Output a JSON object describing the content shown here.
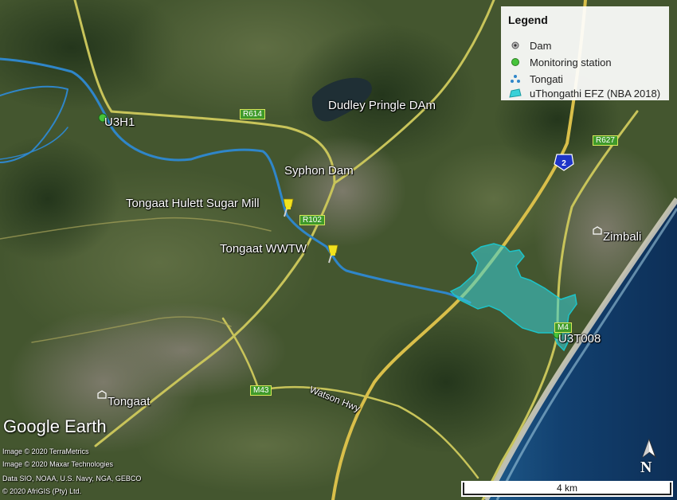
{
  "legend": {
    "title": "Legend",
    "items": [
      {
        "label": "Dam",
        "icon": "dam-point-icon"
      },
      {
        "label": "Monitoring station",
        "icon": "green-circle-icon"
      },
      {
        "label": "Tongati",
        "icon": "river-line-icon"
      },
      {
        "label": "uThongathi EFZ (NBA 2018)",
        "icon": "cyan-polygon-icon"
      }
    ]
  },
  "places": {
    "dudley": "Dudley Pringle DAm",
    "syphon": "Syphon Dam",
    "sugar_mill": "Tongaat Hulett Sugar Mill",
    "wwtw": "Tongaat WWTW",
    "zimbali": "Zimbali",
    "tongaat": "Tongaat",
    "u3h1": "U3H1",
    "u3t008": "U3T008",
    "watson": "Watson Hwy"
  },
  "roads": {
    "r614": "R614",
    "r102": "R102",
    "r627": "R627",
    "m4": "M4",
    "m43": "M43",
    "n2": "2"
  },
  "credits": [
    "Image © 2020 TerraMetrics",
    "Image © 2020 Maxar Technologies",
    "Data SIO, NOAA, U.S. Navy, NGA, GEBCO",
    "© 2020 AfriGIS (Pty) Ltd."
  ],
  "logo": "Google Earth",
  "scale": "4 km",
  "north": "N",
  "colors": {
    "river": "#2f86c9",
    "efz_fill": "#39d1d8",
    "efz_stroke": "#1cc4c9",
    "station": "#46c43a",
    "road": "#c8c45a",
    "road_major": "#d9bf4a",
    "ocean": "#123a6a",
    "pin": "#f2e21e"
  }
}
